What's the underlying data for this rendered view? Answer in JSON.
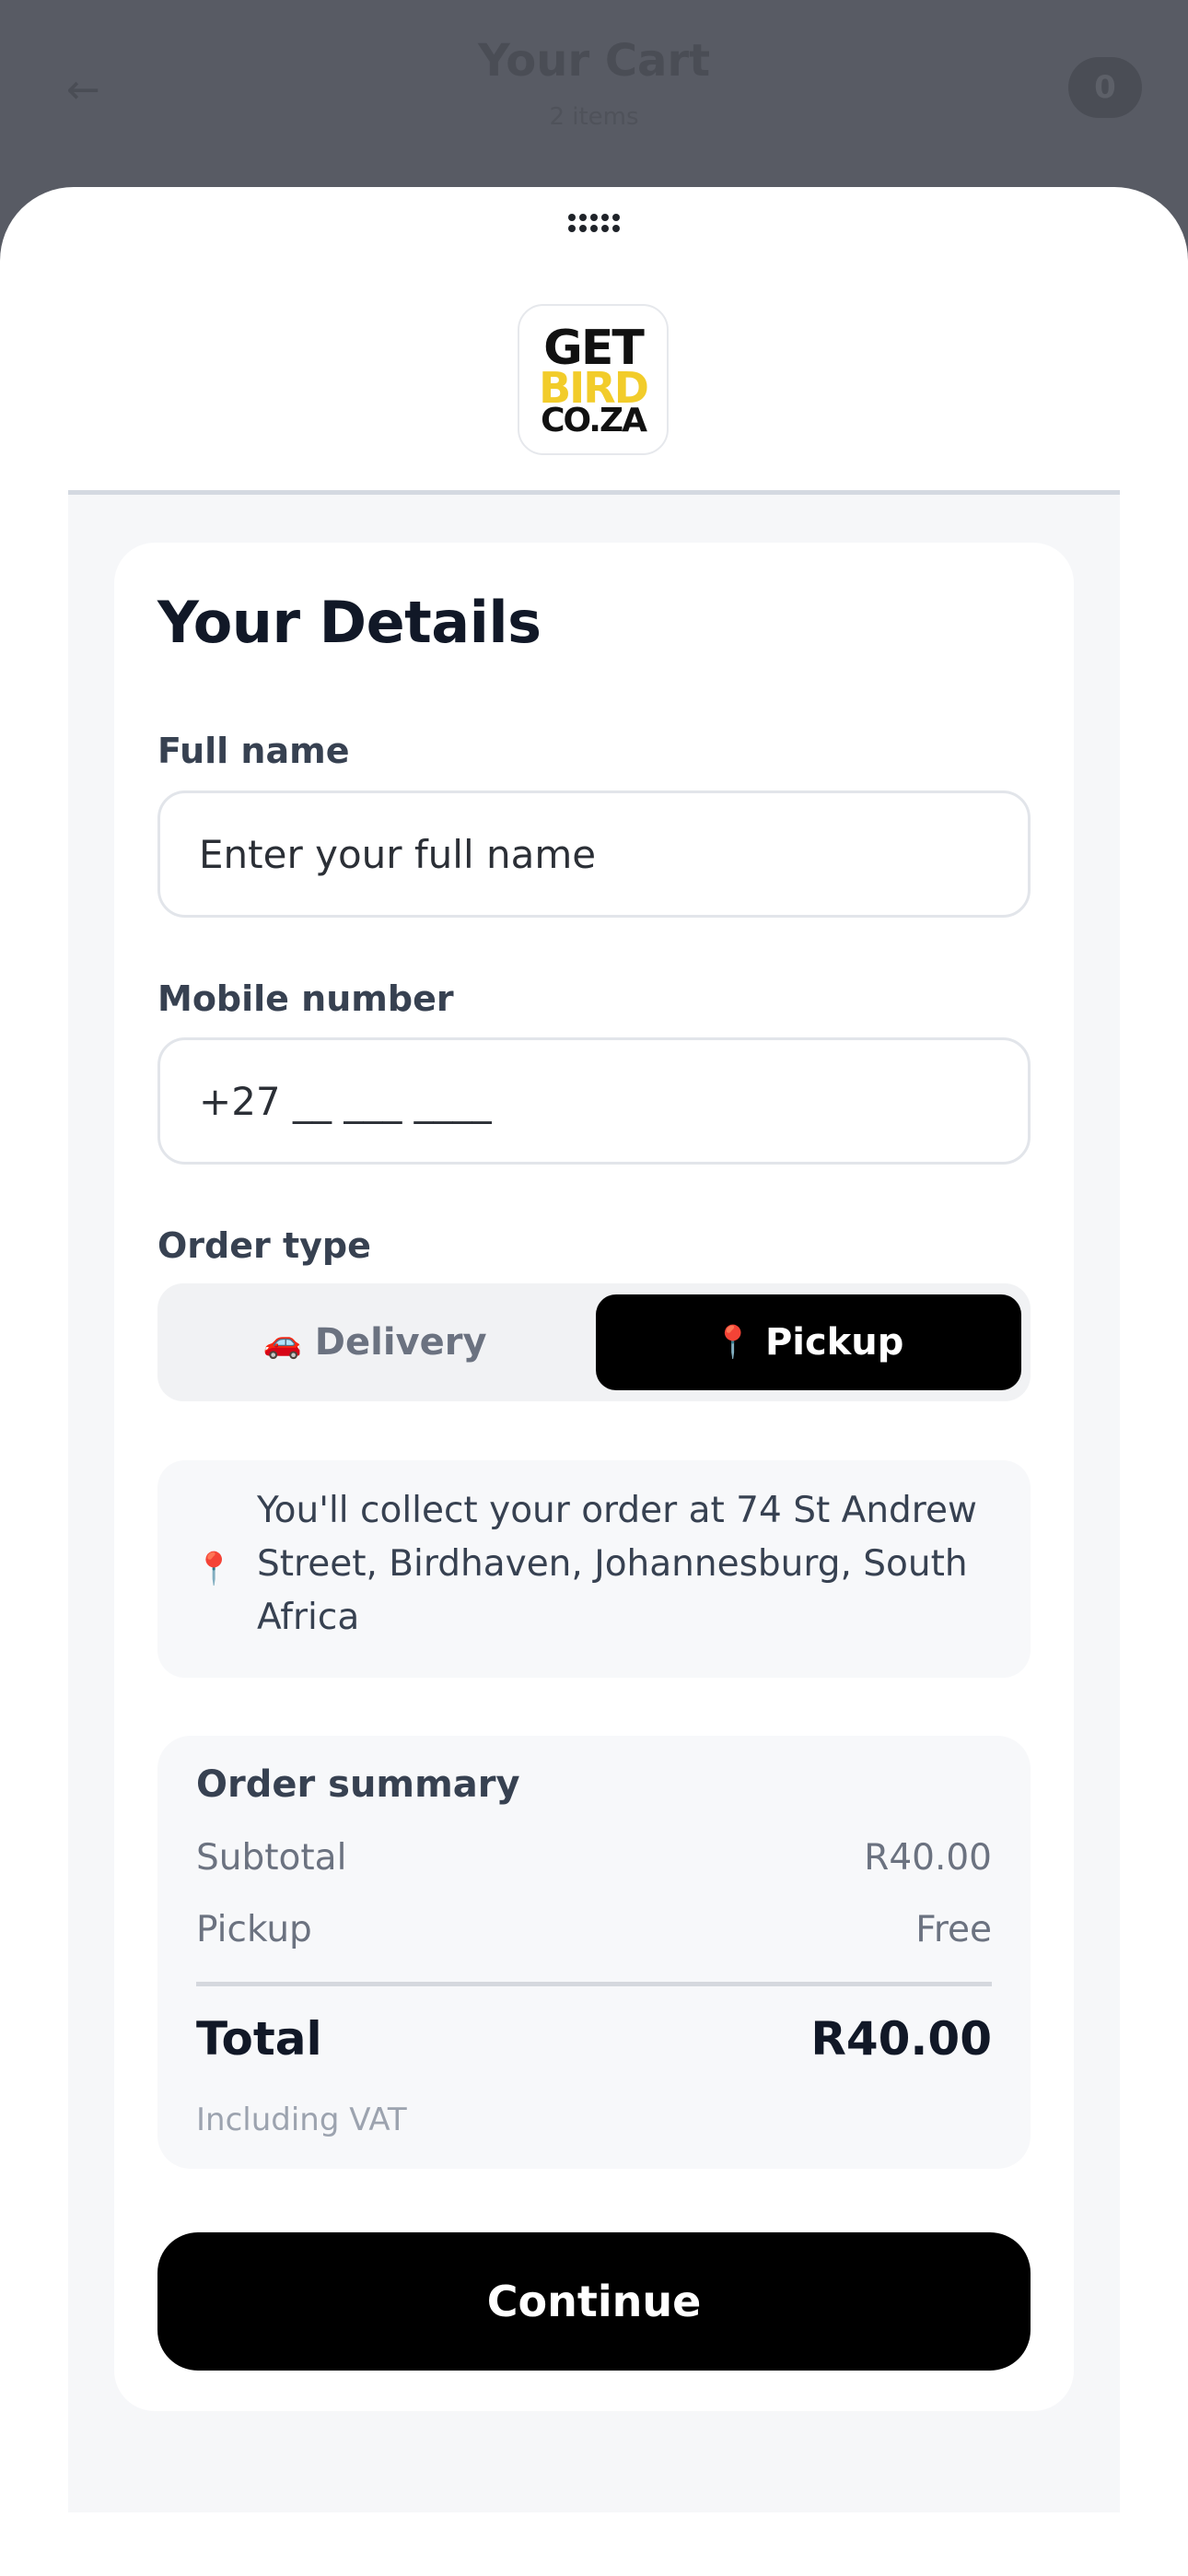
{
  "background": {
    "back_icon": "arrow-left-icon",
    "back_glyph": "←",
    "title": "Your Cart",
    "subtitle": "2 items",
    "badge": "0"
  },
  "sheet": {
    "grabber_icon": "drag-handle-icon",
    "logo": {
      "line1": "GET",
      "line2": "BIRD",
      "line3": "CO.ZA"
    }
  },
  "details": {
    "title": "Your Details",
    "full_name_label": "Full name",
    "full_name_placeholder": "Enter your full name",
    "mobile_label": "Mobile number",
    "mobile_placeholder": "+27 __ ___ ____",
    "order_type_label": "Order type",
    "order_type_options": [
      {
        "label": "Delivery",
        "icon": "car-icon",
        "glyph": "🚗",
        "selected": false
      },
      {
        "label": "Pickup",
        "icon": "pin-icon",
        "glyph": "📍",
        "selected": true
      }
    ],
    "pickup_info": {
      "icon": "pin-icon",
      "glyph": "📍",
      "text": "You'll collect your order at 74 St Andrew Street, Birdhaven, Johannesburg, South Africa"
    },
    "summary": {
      "title": "Order summary",
      "subtotal_label": "Subtotal",
      "subtotal_value": "R40.00",
      "pickup_label": "Pickup",
      "pickup_value": "Free",
      "total_label": "Total",
      "total_value": "R40.00",
      "vat_note": "Including VAT"
    },
    "continue_label": "Continue"
  },
  "colors": {
    "overlay": "#585b64",
    "primary": "#000000",
    "logo_yellow": "#f2cc2a",
    "panel": "#f6f7f9"
  }
}
